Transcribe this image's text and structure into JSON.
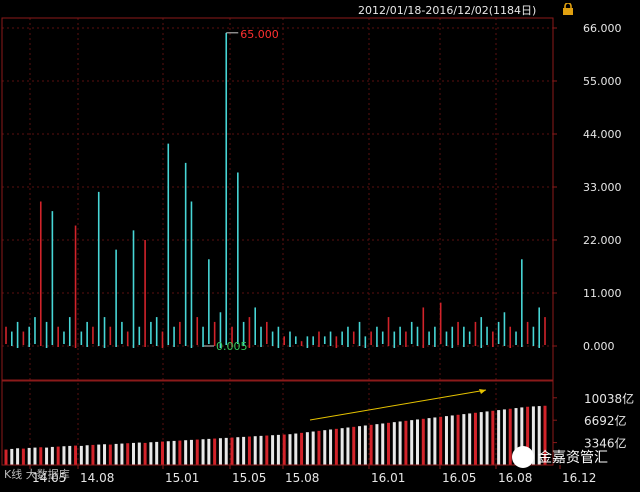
{
  "header": {
    "date_range": "2012/01/18-2016/12/02(1184日)"
  },
  "overlay": {
    "text": "K线 大数据库"
  },
  "watermark": {
    "text": "金嘉资管汇"
  },
  "colors": {
    "up": "#d2232a",
    "down": "#47d6d6",
    "axis": "#8b1a1a",
    "grid": "#5a0f0f",
    "text": "#e6e6e6",
    "max_label": "#ff3030",
    "min_label": "#34c759",
    "trend": "#e6c300"
  },
  "chart_data": [
    {
      "type": "bar",
      "title": "",
      "ylim": [
        0,
        66
      ],
      "y_ticks": [
        "66.000",
        "55.000",
        "44.000",
        "33.000",
        "22.000",
        "11.000",
        "0.000"
      ],
      "y_tick_values": [
        66,
        55,
        44,
        33,
        22,
        11,
        0
      ],
      "x_ticks": [
        "14.05",
        "14.08",
        "15.01",
        "15.05",
        "15.08",
        "16.01",
        "16.05",
        "16.08",
        "16.12"
      ],
      "max_label": "65.000",
      "min_label": "0.005",
      "series": [
        {
          "values": [
            4,
            3,
            5,
            3,
            4,
            6,
            30,
            5,
            28,
            4,
            3,
            6,
            25,
            3,
            5,
            4,
            32,
            6,
            4,
            20,
            5,
            3,
            24,
            4,
            22,
            5,
            6,
            3,
            42,
            4,
            5,
            38,
            30,
            6,
            4,
            18,
            5,
            7,
            65,
            4,
            36,
            5,
            6,
            8,
            4,
            5,
            3,
            4,
            2,
            3,
            2,
            1,
            2,
            2,
            3,
            2,
            3,
            2,
            3,
            4,
            3,
            5,
            2,
            3,
            4,
            3,
            6,
            3,
            4,
            3,
            5,
            4,
            8,
            3,
            4,
            9,
            3,
            4,
            5,
            4,
            3,
            5,
            6,
            4,
            3,
            5,
            7,
            4,
            3,
            18,
            5,
            4,
            8,
            6
          ]
        }
      ]
    },
    {
      "type": "bar",
      "title": "",
      "y_tick_labels": [
        "10038亿",
        "6692亿",
        "3346亿"
      ],
      "y_tick_values": [
        10038,
        6692,
        3346
      ],
      "ylim": [
        0,
        11500
      ],
      "series": [
        {
          "values": [
            2300,
            2400,
            2500,
            2450,
            2550,
            2600,
            2650,
            2600,
            2700,
            2750,
            2800,
            2850,
            2900,
            2850,
            2950,
            3000,
            3050,
            3100,
            3050,
            3150,
            3200,
            3250,
            3300,
            3350,
            3300,
            3400,
            3450,
            3500,
            3550,
            3600,
            3650,
            3700,
            3750,
            3800,
            3850,
            3900,
            3950,
            4000,
            4050,
            4100,
            4150,
            4200,
            4250,
            4300,
            4350,
            4400,
            4450,
            4500,
            4550,
            4600,
            4700,
            4800,
            4900,
            5000,
            5100,
            5200,
            5300,
            5400,
            5500,
            5600,
            5700,
            5800,
            5900,
            6000,
            6100,
            6200,
            6300,
            6400,
            6500,
            6600,
            6700,
            6800,
            6900,
            7000,
            7100,
            7200,
            7300,
            7400,
            7500,
            7600,
            7700,
            7800,
            7900,
            8000,
            8100,
            8200,
            8300,
            8400,
            8500,
            8600,
            8700,
            8750,
            8800,
            8850
          ]
        }
      ]
    }
  ]
}
